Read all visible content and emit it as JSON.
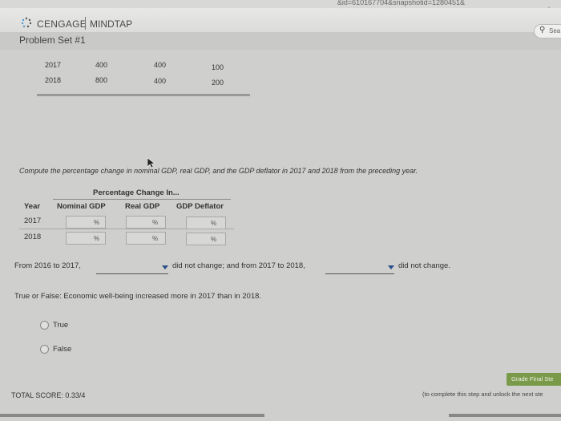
{
  "browser": {
    "url_fragment": "&id=610167704&snapshotid=1280451&"
  },
  "header": {
    "brand": "CENGAGE",
    "product": "MINDTAP",
    "search_placeholder": "Sea"
  },
  "page": {
    "title": "Problem Set #1"
  },
  "data_table": {
    "rows": [
      {
        "year": "2017",
        "c1": "400",
        "c2": "400",
        "c3": "100"
      },
      {
        "year": "2018",
        "c1": "800",
        "c2": "400",
        "c3": "200"
      }
    ]
  },
  "question1": {
    "instructions": "Compute the percentage change in nominal GDP, real GDP, and the GDP deflator in 2017 and 2018 from the preceding year.",
    "group_header": "Percentage Change In...",
    "columns": [
      "Year",
      "Nominal GDP",
      "Real GDP",
      "GDP Deflator"
    ],
    "rows": [
      {
        "year": "2017",
        "unit": "%"
      },
      {
        "year": "2018",
        "unit": "%"
      }
    ]
  },
  "question2": {
    "part1": "From 2016 to 2017,",
    "part2": "did not change; and from 2017 to 2018,",
    "part3": "did not change."
  },
  "question3": {
    "prompt": "True or False: Economic well-being increased more in 2017 than in 2018.",
    "options": [
      "True",
      "False"
    ]
  },
  "footer": {
    "total_score": "TOTAL SCORE: 0.33/4",
    "grade_button": "Grade Final Ste",
    "note": "(to complete this step and unlock the next ste"
  },
  "colors": {
    "grade_button": "#7a9a4a",
    "dropdown_arrow": "#2a4e8a"
  },
  "icons": [
    "cengage-logo-icon",
    "search-icon",
    "star-icon",
    "cursor-icon",
    "dropdown-arrow-icon"
  ]
}
